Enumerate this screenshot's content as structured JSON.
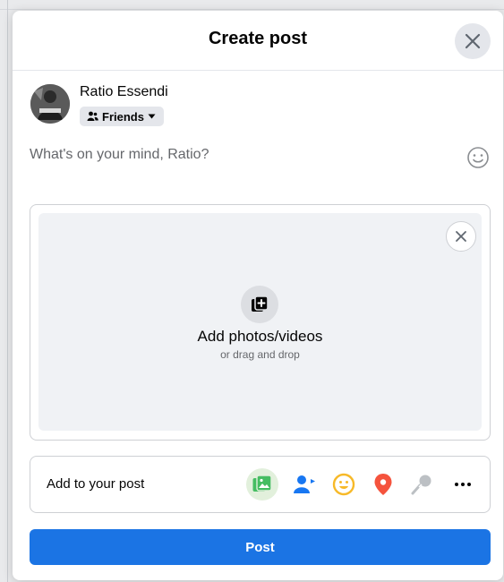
{
  "dialog": {
    "title": "Create post"
  },
  "user": {
    "name": "Ratio Essendi",
    "audience_label": "Friends"
  },
  "composer": {
    "placeholder": "What's on your mind, Ratio?"
  },
  "media": {
    "title": "Add photos/videos",
    "subtitle": "or drag and drop"
  },
  "add_to_post": {
    "label": "Add to your post",
    "tools": [
      {
        "icon": "photo-video-icon",
        "color": "#45bd62"
      },
      {
        "icon": "tag-people-icon",
        "color": "#1877f2"
      },
      {
        "icon": "feeling-icon",
        "color": "#f7b928"
      },
      {
        "icon": "check-in-icon",
        "color": "#f5533d"
      },
      {
        "icon": "microphone-icon",
        "color": "#bcc0c4"
      },
      {
        "icon": "more-icon",
        "color": "#050505"
      }
    ]
  },
  "post_button": {
    "label": "Post"
  },
  "colors": {
    "primary": "#1b74e4",
    "surface": "#ffffff",
    "muted_bg": "#f0f2f5"
  }
}
